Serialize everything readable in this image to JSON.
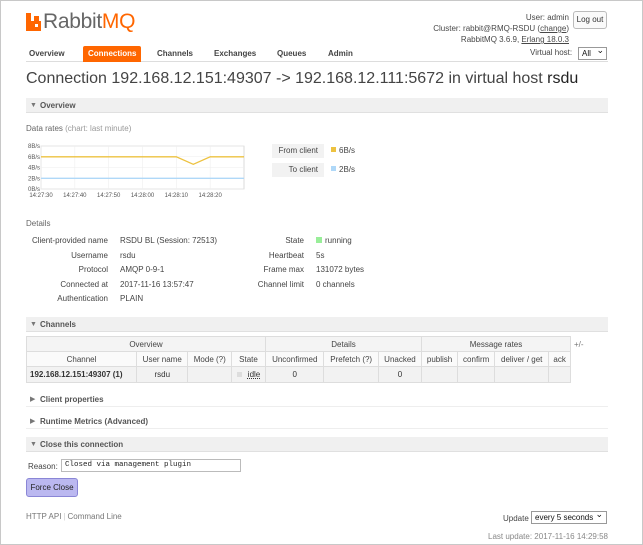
{
  "app": {
    "logo_rabbit": "Rabbit",
    "logo_mq": "MQ"
  },
  "header": {
    "user_label": "User:",
    "user_name": "admin",
    "cluster_label": "Cluster:",
    "cluster_name": "rabbit@RMQ-RSDU",
    "change_link": "change",
    "version": "RabbitMQ 3.6.9,",
    "erlang_link": "Erlang 18.0.3",
    "logout": "Log out"
  },
  "nav": {
    "tabs": [
      "Overview",
      "Connections",
      "Channels",
      "Exchanges",
      "Queues",
      "Admin"
    ],
    "active": "Connections",
    "vhost_label": "Virtual host:",
    "vhost_value": "All"
  },
  "title": {
    "prefix": "Connection 192.168.12.151:49307 -> 192.168.12.111:5672 in virtual host",
    "vhost": "rsdu"
  },
  "sections": {
    "overview": "Overview",
    "data_rates": "Data rates",
    "data_rates_note": "(chart: last minute)",
    "details": "Details",
    "channels": "Channels",
    "client_properties": "Client properties",
    "runtime_metrics": "Runtime Metrics (Advanced)",
    "close_connection": "Close this connection"
  },
  "chart_data": {
    "type": "line",
    "title": "",
    "xlabel": "",
    "ylabel": "",
    "unit": "B/s",
    "x": [
      "14:27:30",
      "14:27:40",
      "14:27:50",
      "14:28:00",
      "14:28:10",
      "14:28:20"
    ],
    "y_ticks": [
      "8B/s",
      "6B/s",
      "4B/s",
      "2B/s",
      "0B/s"
    ],
    "ylim": [
      0,
      8
    ],
    "xlim": [
      0,
      60
    ],
    "series": [
      {
        "name": "From client",
        "color": "#edc240",
        "points": [
          [
            0,
            6
          ],
          [
            10,
            6
          ],
          [
            20,
            6
          ],
          [
            30,
            6
          ],
          [
            40,
            6
          ],
          [
            45,
            4.6
          ],
          [
            50,
            6
          ],
          [
            55,
            6
          ],
          [
            60,
            6
          ]
        ]
      },
      {
        "name": "To client",
        "color": "#afd8f8",
        "points": [
          [
            0,
            2
          ],
          [
            10,
            2
          ],
          [
            20,
            2
          ],
          [
            30,
            2
          ],
          [
            40,
            2
          ],
          [
            50,
            2
          ],
          [
            60,
            2
          ]
        ]
      }
    ]
  },
  "rates_legend": [
    {
      "label": "From client",
      "value": "6B/s",
      "color": "#edc240"
    },
    {
      "label": "To client",
      "value": "2B/s",
      "color": "#afd8f8"
    }
  ],
  "details_left": [
    {
      "key": "Client-provided name",
      "value": "RSDU BL (Session: 72513)"
    },
    {
      "key": "Username",
      "value": "rsdu"
    },
    {
      "key": "Protocol",
      "value": "AMQP 0-9-1"
    },
    {
      "key": "Connected at",
      "value": "2017-11-16 13:57:47"
    },
    {
      "key": "Authentication",
      "value": "PLAIN"
    }
  ],
  "details_right": [
    {
      "key": "State",
      "value": "running"
    },
    {
      "key": "Heartbeat",
      "value": "5s"
    },
    {
      "key": "Frame max",
      "value": "131072 bytes"
    },
    {
      "key": "Channel limit",
      "value": "0 channels"
    }
  ],
  "channels_table": {
    "groups": [
      "Overview",
      "Details",
      "Message rates"
    ],
    "columns": [
      "Channel",
      "User name",
      "Mode (?)",
      "State",
      "Unconfirmed",
      "Prefetch (?)",
      "Unacked",
      "publish",
      "confirm",
      "deliver / get",
      "ack"
    ],
    "rows": [
      [
        "192.168.12.151:49307 (1)",
        "rsdu",
        "",
        "idle",
        "0",
        "",
        "0",
        "",
        "",
        "",
        ""
      ]
    ],
    "plus_minus": "+/-"
  },
  "close": {
    "reason_label": "Reason:",
    "reason_value": "Closed via management plugin",
    "button": "Force Close"
  },
  "footer": {
    "links": [
      "HTTP API",
      "Command Line"
    ],
    "update_label": "Update",
    "update_value": "every 5 seconds",
    "last_update_label": "Last update:",
    "last_update_value": "2017-11-16 14:29:58"
  }
}
